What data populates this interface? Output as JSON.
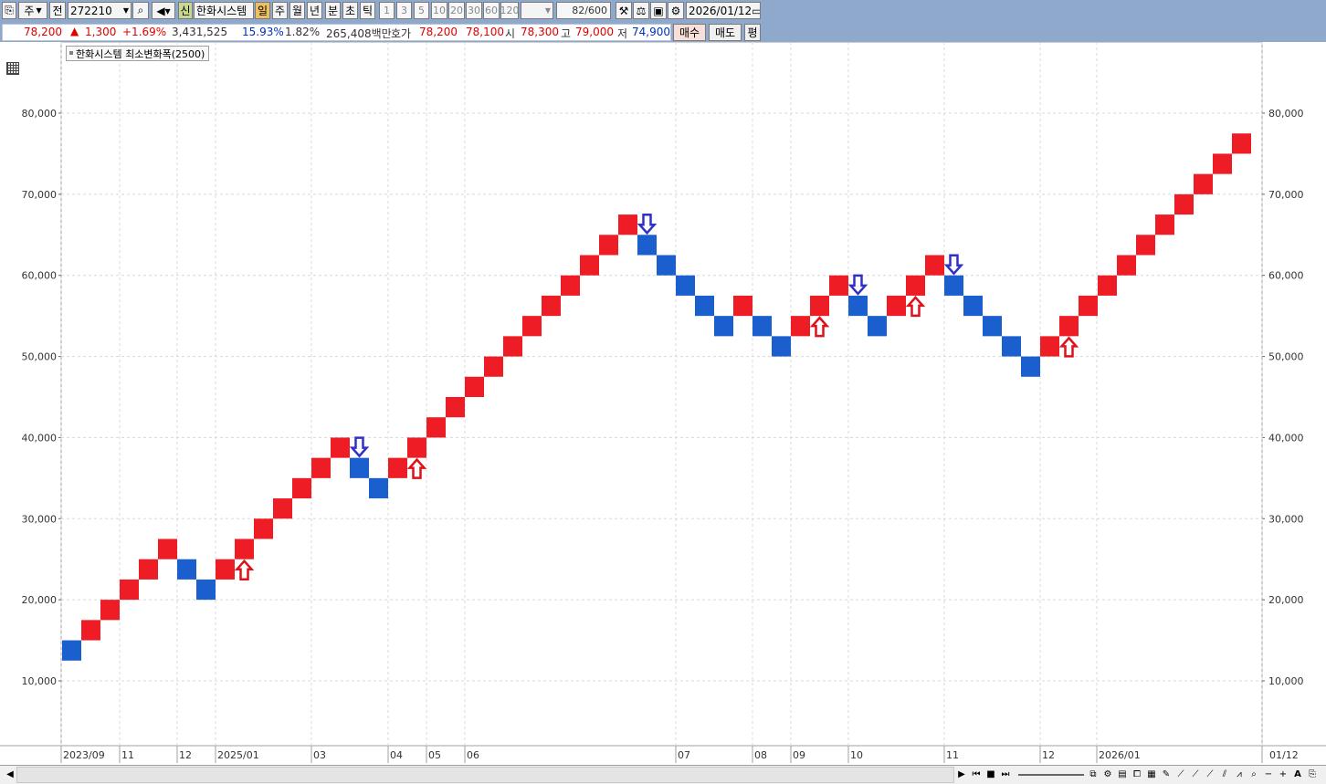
{
  "toolbar": {
    "period_type": "주",
    "all_label": "전",
    "stock_code": "272210",
    "stock_name": "한화시스템",
    "new_label": "신",
    "period_day": "일",
    "period_week": "주",
    "period_month": "월",
    "period_year": "년",
    "period_minute": "분",
    "period_second": "초",
    "period_tick": "틱",
    "intervals": [
      "1",
      "3",
      "5",
      "10",
      "20",
      "30",
      "60",
      "120"
    ],
    "count": "82",
    "count_max": "/600",
    "date": "2026/01/12"
  },
  "quote": {
    "price": "78,200",
    "change": "1,300",
    "change_pct": "+1.69%",
    "volume": "3,431,525",
    "turnover_pct": "15.93%",
    "pct2": "1.82%",
    "amount": "265,408백만",
    "hoga_label": "호가",
    "ask": "78,200",
    "bid": "78,100",
    "open_label": "시",
    "open": "78,300",
    "high_label": "고",
    "high": "79,000",
    "low_label": "저",
    "low": "74,900",
    "buy_label": "매수",
    "sell_label": "매도",
    "eval_label": "평"
  },
  "legend": "한화시스템 최소변화폭(2500)",
  "chart_data": {
    "type": "renko",
    "title": "한화시스템 최소변화폭(2500)",
    "box_size": 2500,
    "ylim": [
      0,
      90000
    ],
    "y_ticks": [
      10000,
      20000,
      30000,
      40000,
      50000,
      60000,
      70000,
      80000
    ],
    "y_tick_labels": [
      "10,000",
      "20,000",
      "30,000",
      "40,000",
      "50,000",
      "60,000",
      "70,000",
      "80,000"
    ],
    "x_tick_labels": [
      "2023/09",
      "11",
      "12",
      "2025/01",
      "03",
      "04",
      "05",
      "06",
      "07",
      "08",
      "09",
      "10",
      "11",
      "12",
      "2026/01",
      "01/12"
    ],
    "bricks": [
      {
        "dir": "down",
        "low": 12500,
        "high": 15000
      },
      {
        "dir": "up",
        "low": 15000,
        "high": 17500
      },
      {
        "dir": "up",
        "low": 17500,
        "high": 20000
      },
      {
        "dir": "up",
        "low": 20000,
        "high": 22500
      },
      {
        "dir": "up",
        "low": 22500,
        "high": 25000
      },
      {
        "dir": "up",
        "low": 25000,
        "high": 27500
      },
      {
        "dir": "down",
        "low": 22500,
        "high": 25000
      },
      {
        "dir": "down",
        "low": 20000,
        "high": 22500
      },
      {
        "dir": "up",
        "low": 22500,
        "high": 25000
      },
      {
        "dir": "up",
        "low": 25000,
        "high": 27500
      },
      {
        "dir": "up",
        "low": 27500,
        "high": 30000
      },
      {
        "dir": "up",
        "low": 30000,
        "high": 32500
      },
      {
        "dir": "up",
        "low": 32500,
        "high": 35000
      },
      {
        "dir": "up",
        "low": 35000,
        "high": 37500
      },
      {
        "dir": "up",
        "low": 37500,
        "high": 40000
      },
      {
        "dir": "down",
        "low": 35000,
        "high": 37500
      },
      {
        "dir": "down",
        "low": 32500,
        "high": 35000
      },
      {
        "dir": "up",
        "low": 35000,
        "high": 37500
      },
      {
        "dir": "up",
        "low": 37500,
        "high": 40000
      },
      {
        "dir": "up",
        "low": 40000,
        "high": 42500
      },
      {
        "dir": "up",
        "low": 42500,
        "high": 45000
      },
      {
        "dir": "up",
        "low": 45000,
        "high": 47500
      },
      {
        "dir": "up",
        "low": 47500,
        "high": 50000
      },
      {
        "dir": "up",
        "low": 50000,
        "high": 52500
      },
      {
        "dir": "up",
        "low": 52500,
        "high": 55000
      },
      {
        "dir": "up",
        "low": 55000,
        "high": 57500
      },
      {
        "dir": "up",
        "low": 57500,
        "high": 60000
      },
      {
        "dir": "up",
        "low": 60000,
        "high": 62500
      },
      {
        "dir": "up",
        "low": 62500,
        "high": 65000
      },
      {
        "dir": "up",
        "low": 65000,
        "high": 67500
      },
      {
        "dir": "down",
        "low": 62500,
        "high": 65000
      },
      {
        "dir": "down",
        "low": 60000,
        "high": 62500
      },
      {
        "dir": "down",
        "low": 57500,
        "high": 60000
      },
      {
        "dir": "down",
        "low": 55000,
        "high": 57500
      },
      {
        "dir": "down",
        "low": 52500,
        "high": 55000
      },
      {
        "dir": "up",
        "low": 55000,
        "high": 57500
      },
      {
        "dir": "down",
        "low": 52500,
        "high": 55000
      },
      {
        "dir": "down",
        "low": 50000,
        "high": 52500
      },
      {
        "dir": "up",
        "low": 52500,
        "high": 55000
      },
      {
        "dir": "up",
        "low": 55000,
        "high": 57500
      },
      {
        "dir": "up",
        "low": 57500,
        "high": 60000
      },
      {
        "dir": "down",
        "low": 55000,
        "high": 57500
      },
      {
        "dir": "down",
        "low": 52500,
        "high": 55000
      },
      {
        "dir": "up",
        "low": 55000,
        "high": 57500
      },
      {
        "dir": "up",
        "low": 57500,
        "high": 60000
      },
      {
        "dir": "up",
        "low": 60000,
        "high": 62500
      },
      {
        "dir": "down",
        "low": 57500,
        "high": 60000
      },
      {
        "dir": "down",
        "low": 55000,
        "high": 57500
      },
      {
        "dir": "down",
        "low": 52500,
        "high": 55000
      },
      {
        "dir": "down",
        "low": 50000,
        "high": 52500
      },
      {
        "dir": "down",
        "low": 47500,
        "high": 50000
      },
      {
        "dir": "up",
        "low": 50000,
        "high": 52500
      },
      {
        "dir": "up",
        "low": 52500,
        "high": 55000
      },
      {
        "dir": "up",
        "low": 55000,
        "high": 57500
      },
      {
        "dir": "up",
        "low": 57500,
        "high": 60000
      },
      {
        "dir": "up",
        "low": 60000,
        "high": 62500
      },
      {
        "dir": "up",
        "low": 62500,
        "high": 65000
      },
      {
        "dir": "up",
        "low": 65000,
        "high": 67500
      },
      {
        "dir": "up",
        "low": 67500,
        "high": 70000
      },
      {
        "dir": "up",
        "low": 70000,
        "high": 72500
      },
      {
        "dir": "up",
        "low": 72500,
        "high": 75000
      },
      {
        "dir": "up",
        "low": 75000,
        "high": 77500
      }
    ],
    "signals": [
      {
        "type": "buy",
        "brick": 9
      },
      {
        "type": "sell",
        "brick": 15
      },
      {
        "type": "buy",
        "brick": 18
      },
      {
        "type": "sell",
        "brick": 30
      },
      {
        "type": "buy",
        "brick": 39
      },
      {
        "type": "sell",
        "brick": 41
      },
      {
        "type": "buy",
        "brick": 44
      },
      {
        "type": "sell",
        "brick": 46
      },
      {
        "type": "buy",
        "brick": 52
      }
    ],
    "colors": {
      "up": "#ee1c24",
      "down": "#1b5fce",
      "buy_arrow": "#e0101a",
      "sell_arrow": "#3030c8",
      "grid": "#d8d8d8"
    },
    "grid": true
  }
}
